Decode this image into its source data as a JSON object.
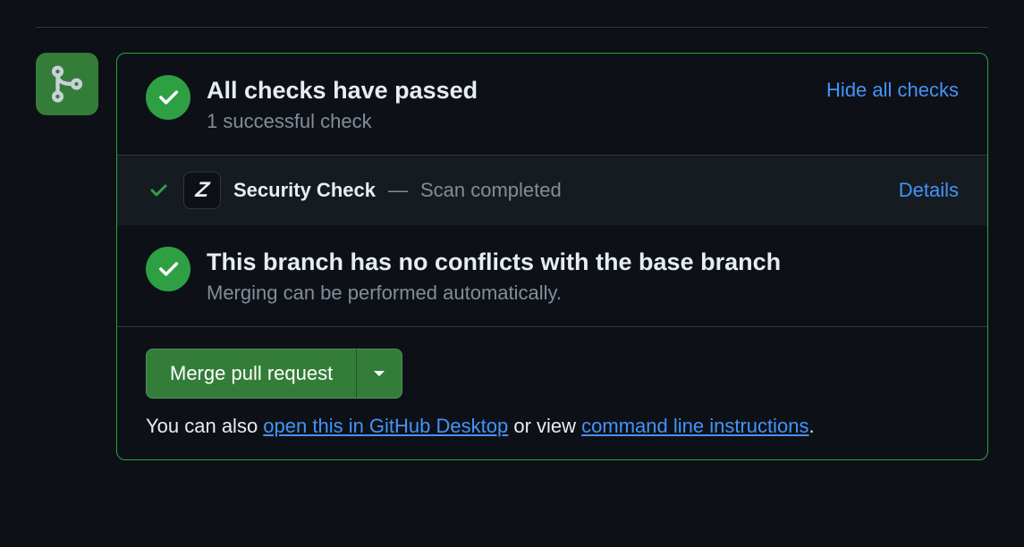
{
  "checks_header": {
    "title": "All checks have passed",
    "subtitle": "1 successful check",
    "toggle_link": "Hide all checks"
  },
  "check_items": [
    {
      "name": "Security Check",
      "separator": " — ",
      "status": "Scan completed",
      "details_label": "Details"
    }
  ],
  "conflicts": {
    "title": "This branch has no conflicts with the base branch",
    "subtitle": "Merging can be performed automatically."
  },
  "merge_button": {
    "label": "Merge pull request"
  },
  "help": {
    "prefix": "You can also ",
    "desktop_link": "open this in GitHub Desktop",
    "middle": " or view ",
    "cli_link": "command line instructions",
    "suffix": "."
  }
}
